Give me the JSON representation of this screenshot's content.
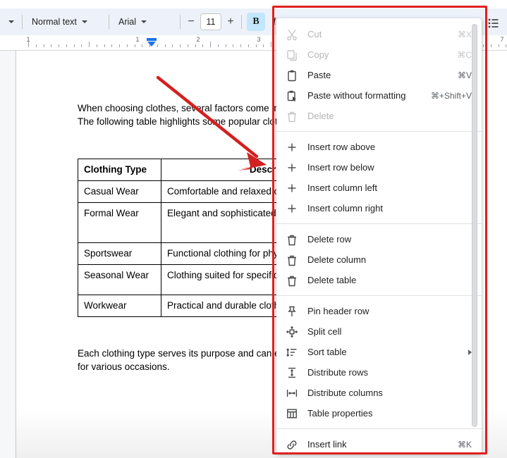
{
  "toolbar": {
    "undo_caret_icon": "chevron-down-icon",
    "style_label": "Normal text",
    "font_label": "Arial",
    "font_size_decrease": "−",
    "font_size_value": "11",
    "font_size_increase": "+",
    "bold_label": "B",
    "italic_label": "I",
    "more_options_icon": "list-icon"
  },
  "ruler": {
    "labels": [
      "1",
      "1",
      "2",
      "3",
      "7"
    ],
    "indent_marker_icon": "indent-marker-icon"
  },
  "document": {
    "paragraph_top_line1": "When choosing clothes, several factors come int",
    "paragraph_top_line2": "The following table highlights some popular cloth",
    "paragraph_bottom_line1": "Each clothing type serves its purpose and can e",
    "paragraph_bottom_line2": "for various occasions.",
    "table": {
      "headers": [
        "Clothing Type",
        "Description"
      ],
      "rows": [
        [
          "Casual Wear",
          "Comfortable and relaxed cloth"
        ],
        [
          "Formal Wear",
          "Elegant and sophisticated atti"
        ],
        [
          "Sportswear",
          "Functional clothing for physica"
        ],
        [
          "Seasonal Wear",
          "Clothing suited for specific we"
        ],
        [
          "Workwear",
          "Practical and durable clothing"
        ]
      ]
    }
  },
  "context_menu": {
    "groups": [
      {
        "items": [
          {
            "label": "Cut",
            "accel": "⌘X",
            "icon": "scissors-icon",
            "disabled": true,
            "submenu": false
          },
          {
            "label": "Copy",
            "accel": "⌘C",
            "icon": "copy-icon",
            "disabled": true,
            "submenu": false
          },
          {
            "label": "Paste",
            "accel": "⌘V",
            "icon": "clipboard-icon",
            "disabled": false,
            "submenu": false
          },
          {
            "label": "Paste without formatting",
            "accel": "⌘+Shift+V",
            "icon": "paste-plain-icon",
            "disabled": false,
            "submenu": false
          },
          {
            "label": "Delete",
            "accel": "",
            "icon": "trash-icon",
            "disabled": true,
            "submenu": false
          }
        ]
      },
      {
        "items": [
          {
            "label": "Insert row above",
            "accel": "",
            "icon": "plus-icon",
            "disabled": false,
            "submenu": false
          },
          {
            "label": "Insert row below",
            "accel": "",
            "icon": "plus-icon",
            "disabled": false,
            "submenu": false
          },
          {
            "label": "Insert column left",
            "accel": "",
            "icon": "plus-icon",
            "disabled": false,
            "submenu": false
          },
          {
            "label": "Insert column right",
            "accel": "",
            "icon": "plus-icon",
            "disabled": false,
            "submenu": false
          }
        ]
      },
      {
        "items": [
          {
            "label": "Delete row",
            "accel": "",
            "icon": "trash-icon",
            "disabled": false,
            "submenu": false
          },
          {
            "label": "Delete column",
            "accel": "",
            "icon": "trash-icon",
            "disabled": false,
            "submenu": false
          },
          {
            "label": "Delete table",
            "accel": "",
            "icon": "trash-icon",
            "disabled": false,
            "submenu": false
          }
        ]
      },
      {
        "items": [
          {
            "label": "Pin header row",
            "accel": "",
            "icon": "pin-icon",
            "disabled": false,
            "submenu": false
          },
          {
            "label": "Split cell",
            "accel": "",
            "icon": "split-cell-icon",
            "disabled": false,
            "submenu": false
          },
          {
            "label": "Sort table",
            "accel": "",
            "icon": "sort-icon",
            "disabled": false,
            "submenu": true
          },
          {
            "label": "Distribute rows",
            "accel": "",
            "icon": "distribute-rows-icon",
            "disabled": false,
            "submenu": false
          },
          {
            "label": "Distribute columns",
            "accel": "",
            "icon": "distribute-columns-icon",
            "disabled": false,
            "submenu": false
          },
          {
            "label": "Table properties",
            "accel": "",
            "icon": "table-icon",
            "disabled": false,
            "submenu": false
          }
        ]
      },
      {
        "items": [
          {
            "label": "Insert link",
            "accel": "⌘K",
            "icon": "link-icon",
            "disabled": false,
            "submenu": false
          }
        ]
      }
    ]
  },
  "annotations": {
    "highlight_color": "#e02020",
    "arrow_color": "#d32020"
  }
}
